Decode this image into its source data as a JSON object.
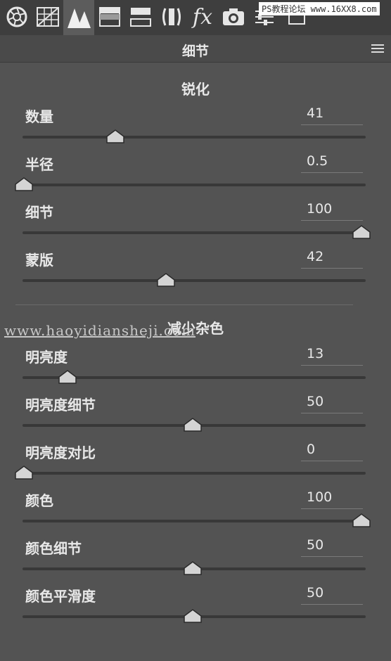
{
  "panel": {
    "title": "细节"
  },
  "watermarks": {
    "top": "PS教程论坛 www.16XX8.com",
    "middle": "www.haoyidiansheji.com"
  },
  "toolbar": {
    "icons": [
      "aperture-icon",
      "grid-icon",
      "mountains-icon",
      "split-tone-icon",
      "hsl-icon",
      "lens-icon",
      "fx-icon",
      "camera-icon",
      "sliders-icon",
      "presets-icon"
    ],
    "fx_label": "fx",
    "active": "mountains-icon"
  },
  "sections": [
    {
      "title": "锐化",
      "sliders": [
        {
          "label": "数量",
          "value": "41",
          "fraction": 0.27
        },
        {
          "label": "半径",
          "value": "0.5",
          "fraction": 0.0
        },
        {
          "label": "细节",
          "value": "100",
          "fraction": 1.0
        },
        {
          "label": "蒙版",
          "value": "42",
          "fraction": 0.42
        }
      ]
    },
    {
      "title": "减少杂色",
      "sliders": [
        {
          "label": "明亮度",
          "value": "13",
          "fraction": 0.13
        },
        {
          "label": "明亮度细节",
          "value": "50",
          "fraction": 0.5
        },
        {
          "label": "明亮度对比",
          "value": "0",
          "fraction": 0.0
        },
        {
          "label": "颜色",
          "value": "100",
          "fraction": 1.0
        },
        {
          "label": "颜色细节",
          "value": "50",
          "fraction": 0.5
        },
        {
          "label": "颜色平滑度",
          "value": "50",
          "fraction": 0.5
        }
      ]
    }
  ]
}
